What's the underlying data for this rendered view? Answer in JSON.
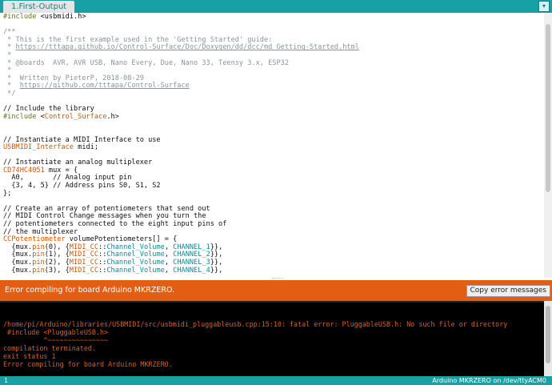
{
  "tabs": [
    {
      "label": "1.First-Output"
    }
  ],
  "tab_menu_glyph": "▾",
  "code_lines": [
    [
      {
        "s": "k",
        "t": "#include "
      },
      {
        "s": "p",
        "t": "<usbmidi.h>"
      }
    ],
    [],
    [
      {
        "s": "c",
        "t": "/**"
      }
    ],
    [
      {
        "s": "c",
        "t": " * This is the first example used in the 'Getting Started' guide:"
      }
    ],
    [
      {
        "s": "c",
        "t": " * "
      },
      {
        "s": "link",
        "t": "https://tttapa.github.io/Control-Surface/Doc/Doxygen/dd/dcc/md_Getting-Started.html"
      }
    ],
    [
      {
        "s": "c",
        "t": " *"
      }
    ],
    [
      {
        "s": "c",
        "t": " * @boards  AVR, AVR USB, Nano Every, Due, Nano 33, Teensy 3.x, ESP32"
      }
    ],
    [
      {
        "s": "c",
        "t": " *"
      }
    ],
    [
      {
        "s": "c",
        "t": " *  Written by PieterP, 2018-08-29"
      }
    ],
    [
      {
        "s": "c",
        "t": " *  "
      },
      {
        "s": "link",
        "t": "https://github.com/tttapa/Control-Surface"
      }
    ],
    [
      {
        "s": "c",
        "t": " */"
      }
    ],
    [],
    [
      {
        "s": "p",
        "t": "// Include the library"
      }
    ],
    [
      {
        "s": "k",
        "t": "#include "
      },
      {
        "s": "p",
        "t": "<"
      },
      {
        "s": "t",
        "t": "Control_Surface"
      },
      {
        "s": "p",
        "t": ".h>"
      }
    ],
    [],
    [],
    [
      {
        "s": "p",
        "t": "// Instantiate a MIDI Interface to use"
      }
    ],
    [
      {
        "s": "t",
        "t": "USBMIDI_Interface"
      },
      {
        "s": "p",
        "t": " midi;"
      }
    ],
    [],
    [
      {
        "s": "p",
        "t": "// Instantiate an analog multiplexer"
      }
    ],
    [
      {
        "s": "t",
        "t": "CD74HC4051"
      },
      {
        "s": "p",
        "t": " mux = {"
      }
    ],
    [
      {
        "s": "p",
        "t": "  A0,       // Analog input pin"
      }
    ],
    [
      {
        "s": "p",
        "t": "  {3, 4, 5} // Address pins S0, S1, S2"
      }
    ],
    [
      {
        "s": "p",
        "t": "};"
      }
    ],
    [],
    [
      {
        "s": "p",
        "t": "// Create an array of potentiometers that send out"
      }
    ],
    [
      {
        "s": "p",
        "t": "// MIDI Control Change messages when you turn the"
      }
    ],
    [
      {
        "s": "p",
        "t": "// potentiometers connected to the eight input pins of"
      }
    ],
    [
      {
        "s": "p",
        "t": "// the multiplexer"
      }
    ],
    [
      {
        "s": "t",
        "t": "CCPotentiometer"
      },
      {
        "s": "p",
        "t": " volumePotentiometers[] = {"
      }
    ],
    [
      {
        "s": "p",
        "t": "  {mux."
      },
      {
        "s": "fn",
        "t": "pin"
      },
      {
        "s": "p",
        "t": "(0), {"
      },
      {
        "s": "t",
        "t": "MIDI_CC"
      },
      {
        "s": "p",
        "t": "::"
      },
      {
        "s": "cc",
        "t": "Channel_Volume"
      },
      {
        "s": "p",
        "t": ", "
      },
      {
        "s": "cc",
        "t": "CHANNEL_1"
      },
      {
        "s": "p",
        "t": "}},"
      }
    ],
    [
      {
        "s": "p",
        "t": "  {mux."
      },
      {
        "s": "fn",
        "t": "pin"
      },
      {
        "s": "p",
        "t": "(1), {"
      },
      {
        "s": "t",
        "t": "MIDI_CC"
      },
      {
        "s": "p",
        "t": "::"
      },
      {
        "s": "cc",
        "t": "Channel_Volume"
      },
      {
        "s": "p",
        "t": ", "
      },
      {
        "s": "cc",
        "t": "CHANNEL_2"
      },
      {
        "s": "p",
        "t": "}},"
      }
    ],
    [
      {
        "s": "p",
        "t": "  {mux."
      },
      {
        "s": "fn",
        "t": "pin"
      },
      {
        "s": "p",
        "t": "(2), {"
      },
      {
        "s": "t",
        "t": "MIDI_CC"
      },
      {
        "s": "p",
        "t": "::"
      },
      {
        "s": "cc",
        "t": "Channel_Volume"
      },
      {
        "s": "p",
        "t": ", "
      },
      {
        "s": "cc",
        "t": "CHANNEL_3"
      },
      {
        "s": "p",
        "t": "}},"
      }
    ],
    [
      {
        "s": "p",
        "t": "  {mux."
      },
      {
        "s": "fn",
        "t": "pin"
      },
      {
        "s": "p",
        "t": "(3), {"
      },
      {
        "s": "t",
        "t": "MIDI_CC"
      },
      {
        "s": "p",
        "t": "::"
      },
      {
        "s": "cc",
        "t": "Channel_Volume"
      },
      {
        "s": "p",
        "t": ", "
      },
      {
        "s": "cc",
        "t": "CHANNEL_4"
      },
      {
        "s": "p",
        "t": "}},"
      }
    ]
  ],
  "status": {
    "message": "Error compiling for board Arduino MKRZERO.",
    "copy_button_label": "Copy error messages"
  },
  "console_lines": [
    "/home/pi/Arduino/libraries/USBMIDI/src/usbmidi_pluggableusb.cpp:15:10: fatal error: PluggableUSB.h: No such file or directory",
    " #include <PluggableUSB.h>",
    "          ^~~~~~~~~~~~~~~~",
    "compilation terminated.",
    "exit status 1",
    "Error compiling for board Arduino MKRZERO."
  ],
  "footer": {
    "line_number": "1",
    "board_port": "Arduino MKRZERO on /dev/ttyACM0"
  },
  "colors": {
    "accent_teal": "#17a1a5",
    "error_orange": "#e35d12",
    "console_bg": "#000000"
  }
}
